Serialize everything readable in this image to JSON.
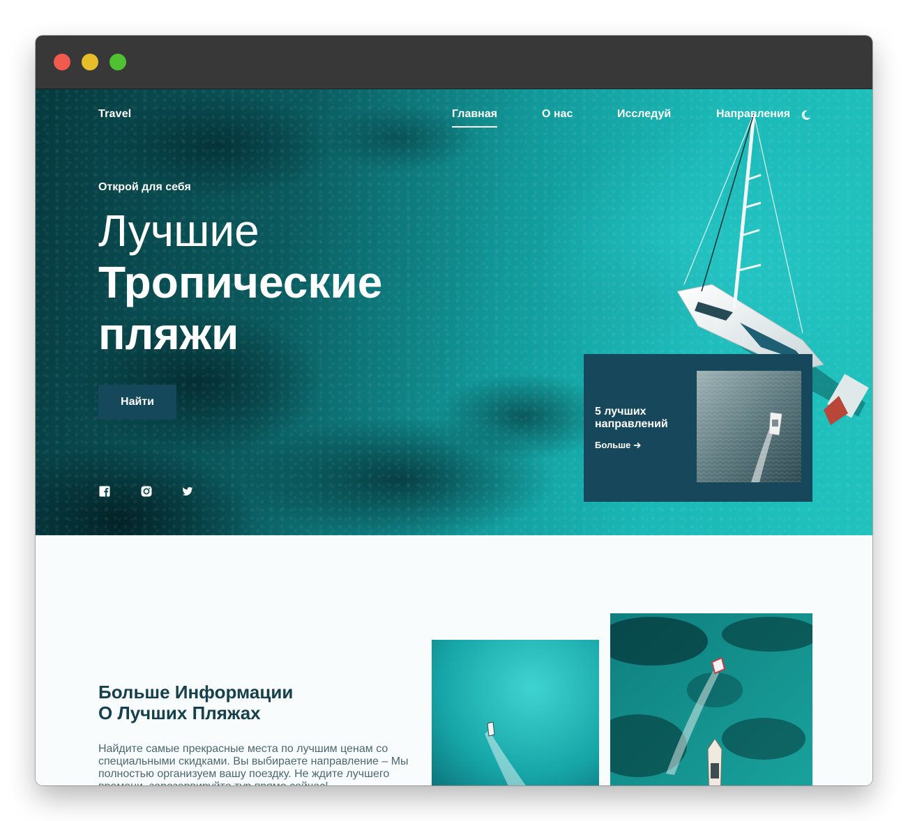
{
  "site": {
    "brand": "Travel"
  },
  "nav": {
    "items": [
      {
        "label": "Главная",
        "active": true
      },
      {
        "label": "О нас",
        "active": false
      },
      {
        "label": "Исследуй",
        "active": false
      },
      {
        "label": "Направления",
        "active": false
      }
    ],
    "theme_icon": "moon-icon"
  },
  "hero": {
    "subtitle": "Открой для себя",
    "title_light": "Лучшие",
    "title_bold_1": "Тропические",
    "title_bold_2": "пляжи",
    "cta_label": "Найти",
    "social_icons": [
      "facebook-icon",
      "instagram-icon",
      "twitter-icon"
    ]
  },
  "promo": {
    "title": "5 лучших направлений",
    "link_label": "Больше",
    "link_icon": "arrow-right-icon"
  },
  "about": {
    "title_line1": "Больше Информации",
    "title_line2": "О Лучших Пляжах",
    "text": "Найдите самые прекрасные места по лучшим ценам со специальными скидками. Вы выбираете направление – Мы полностью организуем вашу поездку. Не ждите лучшего времени, зарезервируйте тур прямо сейчас!"
  },
  "colors": {
    "titlebar": "#383838",
    "accent_dark": "#15485a",
    "heading": "#15404c",
    "body_text": "#4b6670",
    "page_bg": "#f8fcfd"
  }
}
